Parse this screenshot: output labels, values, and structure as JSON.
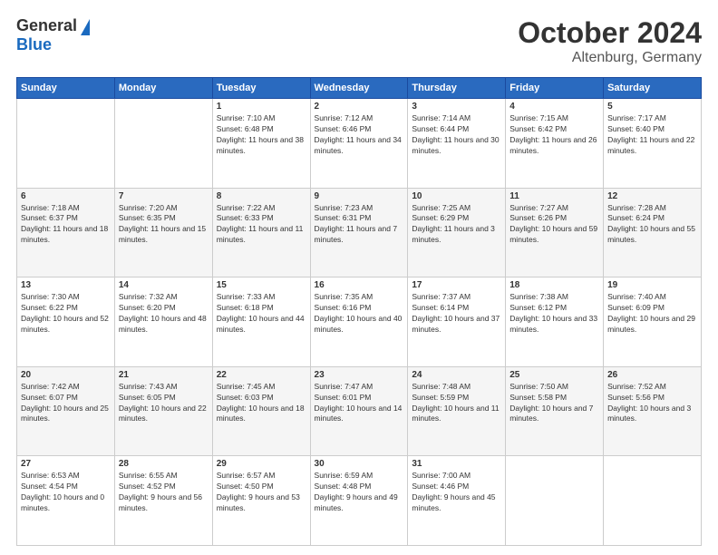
{
  "header": {
    "logo_general": "General",
    "logo_blue": "Blue",
    "month_title": "October 2024",
    "location": "Altenburg, Germany"
  },
  "days_of_week": [
    "Sunday",
    "Monday",
    "Tuesday",
    "Wednesday",
    "Thursday",
    "Friday",
    "Saturday"
  ],
  "weeks": [
    [
      {
        "day": "",
        "sunrise": "",
        "sunset": "",
        "daylight": ""
      },
      {
        "day": "",
        "sunrise": "",
        "sunset": "",
        "daylight": ""
      },
      {
        "day": "1",
        "sunrise": "Sunrise: 7:10 AM",
        "sunset": "Sunset: 6:48 PM",
        "daylight": "Daylight: 11 hours and 38 minutes."
      },
      {
        "day": "2",
        "sunrise": "Sunrise: 7:12 AM",
        "sunset": "Sunset: 6:46 PM",
        "daylight": "Daylight: 11 hours and 34 minutes."
      },
      {
        "day": "3",
        "sunrise": "Sunrise: 7:14 AM",
        "sunset": "Sunset: 6:44 PM",
        "daylight": "Daylight: 11 hours and 30 minutes."
      },
      {
        "day": "4",
        "sunrise": "Sunrise: 7:15 AM",
        "sunset": "Sunset: 6:42 PM",
        "daylight": "Daylight: 11 hours and 26 minutes."
      },
      {
        "day": "5",
        "sunrise": "Sunrise: 7:17 AM",
        "sunset": "Sunset: 6:40 PM",
        "daylight": "Daylight: 11 hours and 22 minutes."
      }
    ],
    [
      {
        "day": "6",
        "sunrise": "Sunrise: 7:18 AM",
        "sunset": "Sunset: 6:37 PM",
        "daylight": "Daylight: 11 hours and 18 minutes."
      },
      {
        "day": "7",
        "sunrise": "Sunrise: 7:20 AM",
        "sunset": "Sunset: 6:35 PM",
        "daylight": "Daylight: 11 hours and 15 minutes."
      },
      {
        "day": "8",
        "sunrise": "Sunrise: 7:22 AM",
        "sunset": "Sunset: 6:33 PM",
        "daylight": "Daylight: 11 hours and 11 minutes."
      },
      {
        "day": "9",
        "sunrise": "Sunrise: 7:23 AM",
        "sunset": "Sunset: 6:31 PM",
        "daylight": "Daylight: 11 hours and 7 minutes."
      },
      {
        "day": "10",
        "sunrise": "Sunrise: 7:25 AM",
        "sunset": "Sunset: 6:29 PM",
        "daylight": "Daylight: 11 hours and 3 minutes."
      },
      {
        "day": "11",
        "sunrise": "Sunrise: 7:27 AM",
        "sunset": "Sunset: 6:26 PM",
        "daylight": "Daylight: 10 hours and 59 minutes."
      },
      {
        "day": "12",
        "sunrise": "Sunrise: 7:28 AM",
        "sunset": "Sunset: 6:24 PM",
        "daylight": "Daylight: 10 hours and 55 minutes."
      }
    ],
    [
      {
        "day": "13",
        "sunrise": "Sunrise: 7:30 AM",
        "sunset": "Sunset: 6:22 PM",
        "daylight": "Daylight: 10 hours and 52 minutes."
      },
      {
        "day": "14",
        "sunrise": "Sunrise: 7:32 AM",
        "sunset": "Sunset: 6:20 PM",
        "daylight": "Daylight: 10 hours and 48 minutes."
      },
      {
        "day": "15",
        "sunrise": "Sunrise: 7:33 AM",
        "sunset": "Sunset: 6:18 PM",
        "daylight": "Daylight: 10 hours and 44 minutes."
      },
      {
        "day": "16",
        "sunrise": "Sunrise: 7:35 AM",
        "sunset": "Sunset: 6:16 PM",
        "daylight": "Daylight: 10 hours and 40 minutes."
      },
      {
        "day": "17",
        "sunrise": "Sunrise: 7:37 AM",
        "sunset": "Sunset: 6:14 PM",
        "daylight": "Daylight: 10 hours and 37 minutes."
      },
      {
        "day": "18",
        "sunrise": "Sunrise: 7:38 AM",
        "sunset": "Sunset: 6:12 PM",
        "daylight": "Daylight: 10 hours and 33 minutes."
      },
      {
        "day": "19",
        "sunrise": "Sunrise: 7:40 AM",
        "sunset": "Sunset: 6:09 PM",
        "daylight": "Daylight: 10 hours and 29 minutes."
      }
    ],
    [
      {
        "day": "20",
        "sunrise": "Sunrise: 7:42 AM",
        "sunset": "Sunset: 6:07 PM",
        "daylight": "Daylight: 10 hours and 25 minutes."
      },
      {
        "day": "21",
        "sunrise": "Sunrise: 7:43 AM",
        "sunset": "Sunset: 6:05 PM",
        "daylight": "Daylight: 10 hours and 22 minutes."
      },
      {
        "day": "22",
        "sunrise": "Sunrise: 7:45 AM",
        "sunset": "Sunset: 6:03 PM",
        "daylight": "Daylight: 10 hours and 18 minutes."
      },
      {
        "day": "23",
        "sunrise": "Sunrise: 7:47 AM",
        "sunset": "Sunset: 6:01 PM",
        "daylight": "Daylight: 10 hours and 14 minutes."
      },
      {
        "day": "24",
        "sunrise": "Sunrise: 7:48 AM",
        "sunset": "Sunset: 5:59 PM",
        "daylight": "Daylight: 10 hours and 11 minutes."
      },
      {
        "day": "25",
        "sunrise": "Sunrise: 7:50 AM",
        "sunset": "Sunset: 5:58 PM",
        "daylight": "Daylight: 10 hours and 7 minutes."
      },
      {
        "day": "26",
        "sunrise": "Sunrise: 7:52 AM",
        "sunset": "Sunset: 5:56 PM",
        "daylight": "Daylight: 10 hours and 3 minutes."
      }
    ],
    [
      {
        "day": "27",
        "sunrise": "Sunrise: 6:53 AM",
        "sunset": "Sunset: 4:54 PM",
        "daylight": "Daylight: 10 hours and 0 minutes."
      },
      {
        "day": "28",
        "sunrise": "Sunrise: 6:55 AM",
        "sunset": "Sunset: 4:52 PM",
        "daylight": "Daylight: 9 hours and 56 minutes."
      },
      {
        "day": "29",
        "sunrise": "Sunrise: 6:57 AM",
        "sunset": "Sunset: 4:50 PM",
        "daylight": "Daylight: 9 hours and 53 minutes."
      },
      {
        "day": "30",
        "sunrise": "Sunrise: 6:59 AM",
        "sunset": "Sunset: 4:48 PM",
        "daylight": "Daylight: 9 hours and 49 minutes."
      },
      {
        "day": "31",
        "sunrise": "Sunrise: 7:00 AM",
        "sunset": "Sunset: 4:46 PM",
        "daylight": "Daylight: 9 hours and 45 minutes."
      },
      {
        "day": "",
        "sunrise": "",
        "sunset": "",
        "daylight": ""
      },
      {
        "day": "",
        "sunrise": "",
        "sunset": "",
        "daylight": ""
      }
    ]
  ]
}
